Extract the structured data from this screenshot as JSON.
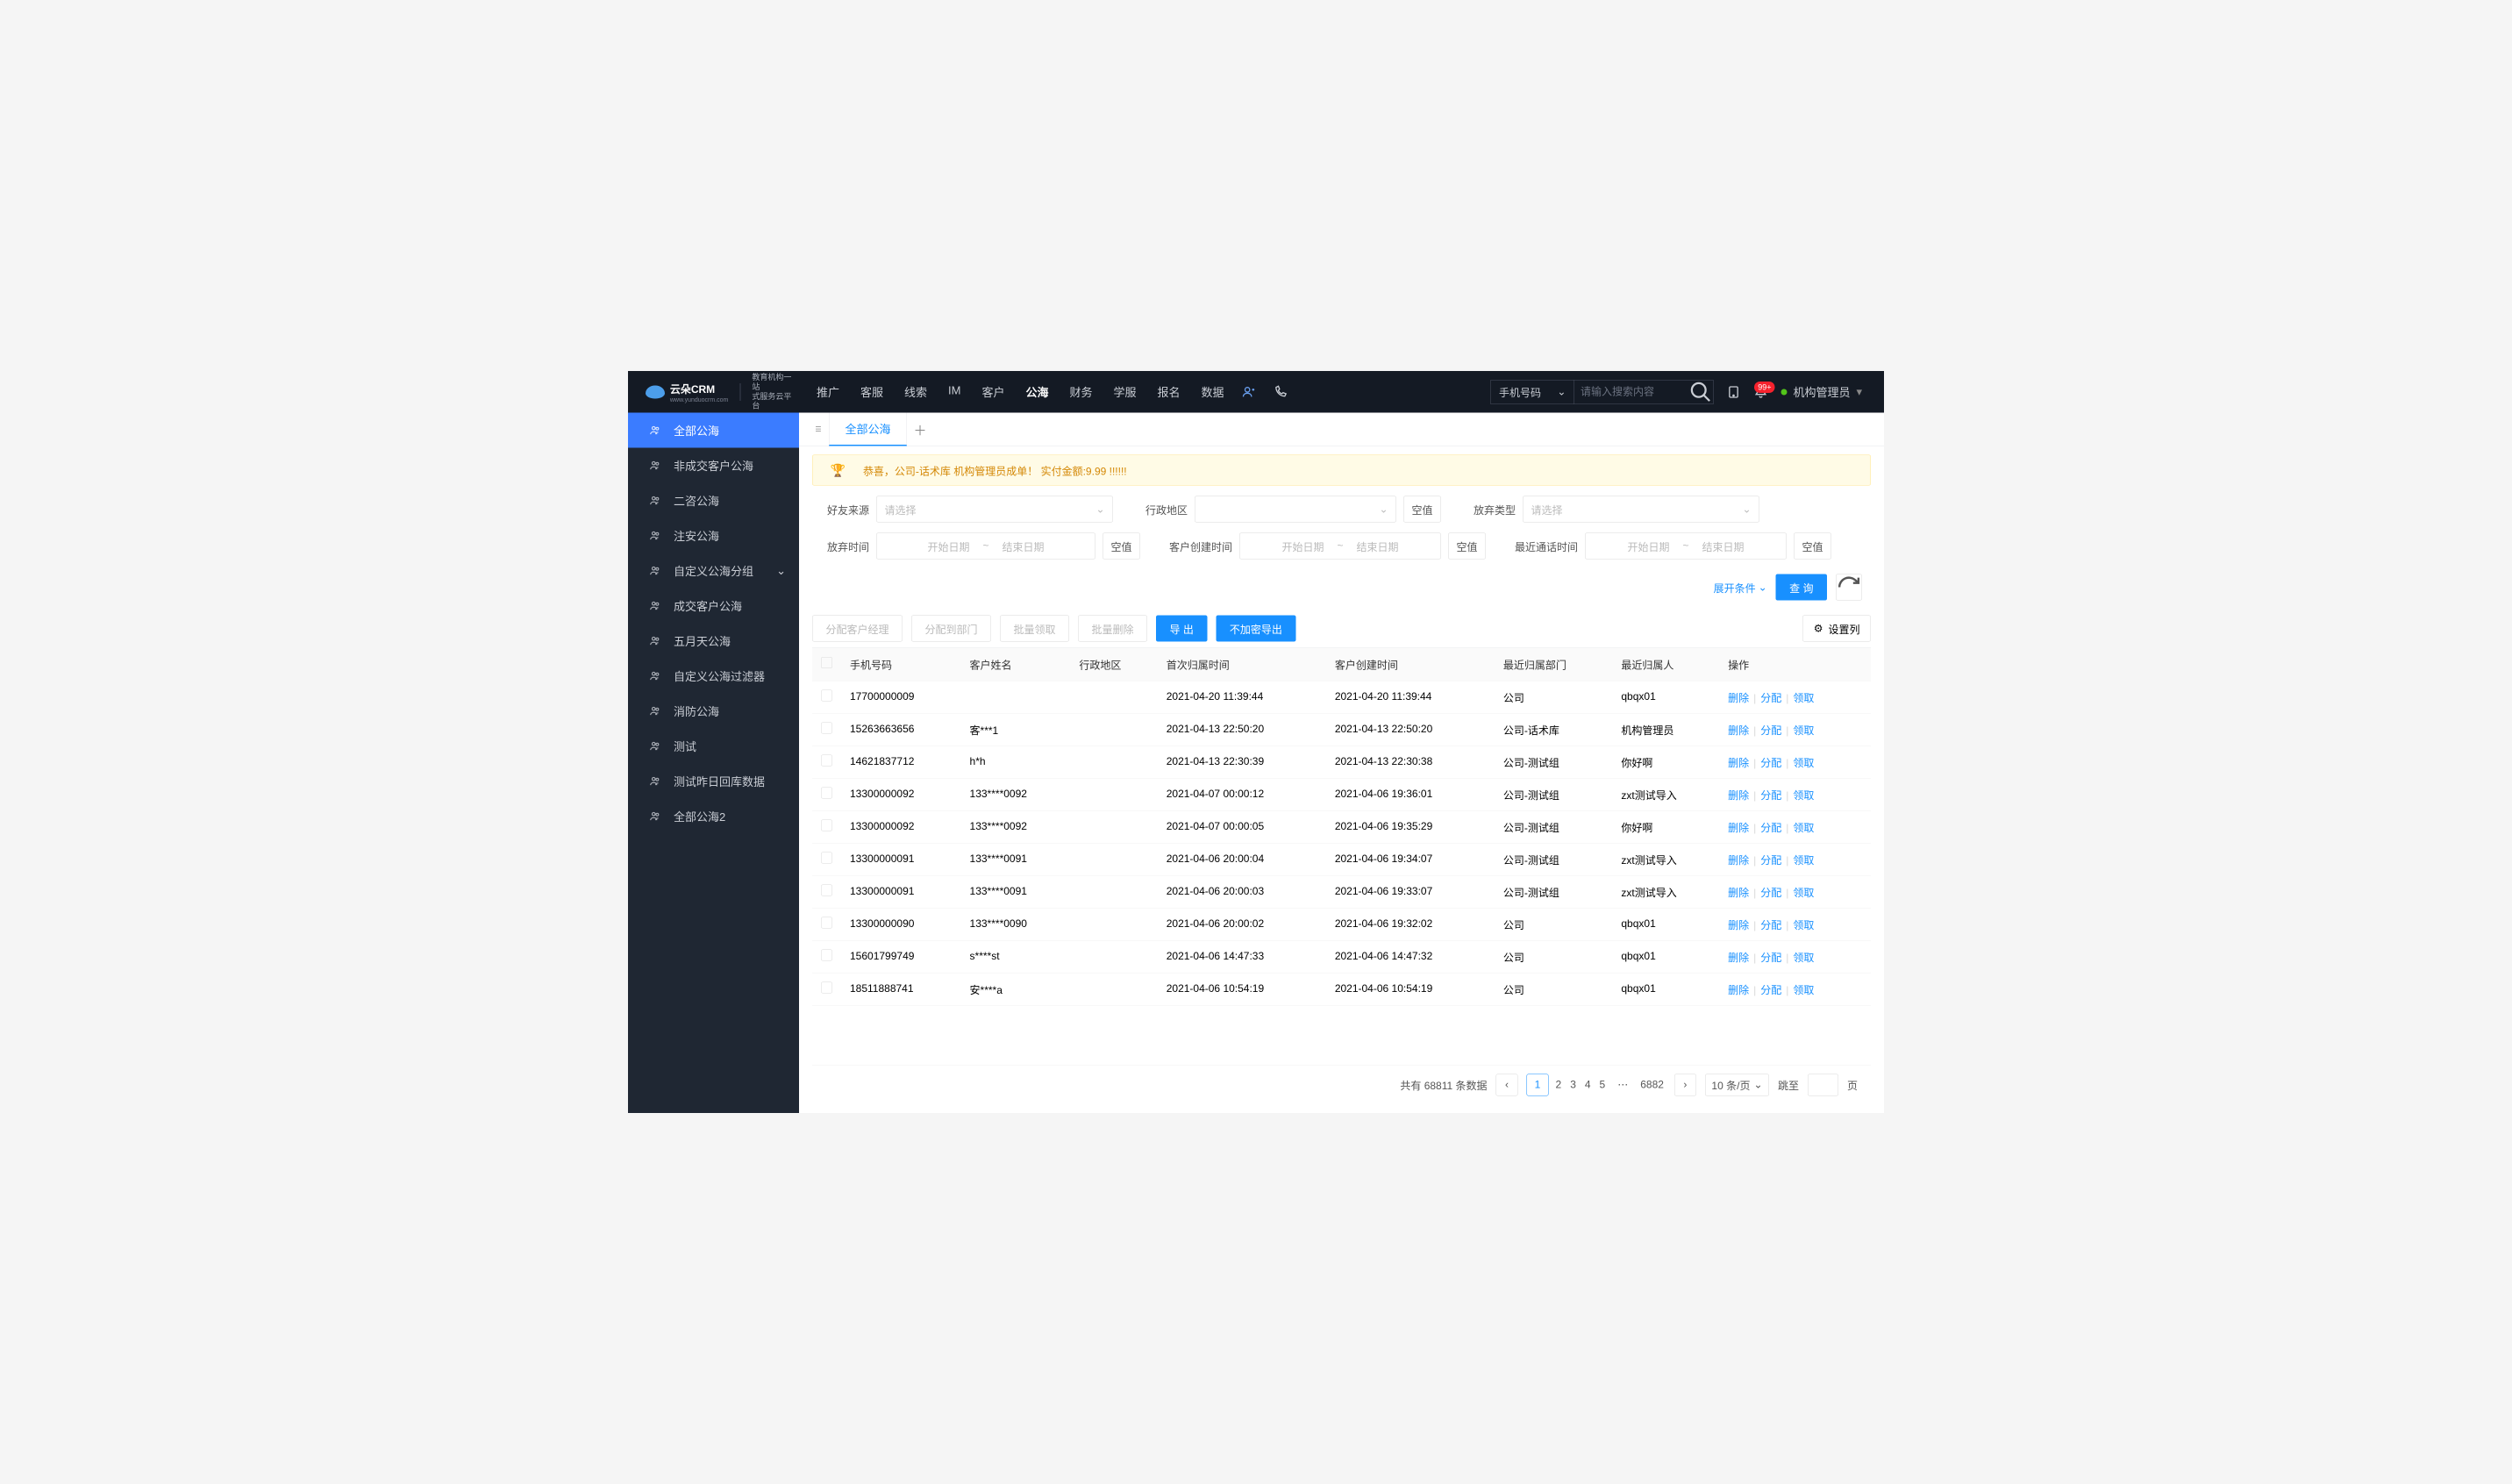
{
  "logo": {
    "brand": "云朵CRM",
    "sub1": "教育机构一站",
    "sub2": "式服务云平台",
    "url": "www.yunduocrm.com"
  },
  "nav": [
    "推广",
    "客服",
    "线索",
    "IM",
    "客户",
    "公海",
    "财务",
    "学服",
    "报名",
    "数据"
  ],
  "nav_active": 5,
  "search": {
    "type": "手机号码",
    "placeholder": "请输入搜索内容"
  },
  "notif_badge": "99+",
  "user": "机构管理员",
  "sidebar": [
    {
      "label": "全部公海",
      "active": true
    },
    {
      "label": "非成交客户公海"
    },
    {
      "label": "二咨公海"
    },
    {
      "label": "注安公海"
    },
    {
      "label": "自定义公海分组",
      "expand": true
    },
    {
      "label": "成交客户公海"
    },
    {
      "label": "五月天公海"
    },
    {
      "label": "自定义公海过滤器"
    },
    {
      "label": "消防公海"
    },
    {
      "label": "测试"
    },
    {
      "label": "测试昨日回库数据"
    },
    {
      "label": "全部公海2"
    }
  ],
  "tabs": {
    "active": "全部公海"
  },
  "banner": "恭喜，公司-话术库  机构管理员成单！  实付金额:9.99 !!!!!!",
  "filters": {
    "friend_source": {
      "label": "好友来源",
      "ph": "请选择"
    },
    "region": {
      "label": "行政地区",
      "ph": ""
    },
    "abandon_type": {
      "label": "放弃类型",
      "ph": "请选择"
    },
    "abandon_time": {
      "label": "放弃时间"
    },
    "create_time": {
      "label": "客户创建时间"
    },
    "call_time": {
      "label": "最近通话时间"
    },
    "date_start": "开始日期",
    "date_end": "结束日期",
    "null_btn": "空值",
    "expand": "展开条件",
    "query": "查 询"
  },
  "toolbar": {
    "assign_mgr": "分配客户经理",
    "assign_dept": "分配到部门",
    "batch_claim": "批量领取",
    "batch_del": "批量删除",
    "export": "导 出",
    "export_plain": "不加密导出",
    "set_cols": "设置列"
  },
  "table": {
    "cols": [
      "手机号码",
      "客户姓名",
      "行政地区",
      "首次归属时间",
      "客户创建时间",
      "最近归属部门",
      "最近归属人",
      "操作"
    ],
    "op": {
      "del": "删除",
      "assign": "分配",
      "claim": "领取"
    },
    "rows": [
      {
        "phone": "17700000009",
        "name": "",
        "region": "",
        "first": "2021-04-20 11:39:44",
        "created": "2021-04-20 11:39:44",
        "dept": "公司",
        "owner": "qbqx01"
      },
      {
        "phone": "15263663656",
        "name": "客***1",
        "region": "",
        "first": "2021-04-13 22:50:20",
        "created": "2021-04-13 22:50:20",
        "dept": "公司-话术库",
        "owner": "机构管理员"
      },
      {
        "phone": "14621837712",
        "name": "h*h",
        "region": "",
        "first": "2021-04-13 22:30:39",
        "created": "2021-04-13 22:30:38",
        "dept": "公司-测试组",
        "owner": "你好啊"
      },
      {
        "phone": "13300000092",
        "name": "133****0092",
        "region": "",
        "first": "2021-04-07 00:00:12",
        "created": "2021-04-06 19:36:01",
        "dept": "公司-测试组",
        "owner": "zxt测试导入"
      },
      {
        "phone": "13300000092",
        "name": "133****0092",
        "region": "",
        "first": "2021-04-07 00:00:05",
        "created": "2021-04-06 19:35:29",
        "dept": "公司-测试组",
        "owner": "你好啊"
      },
      {
        "phone": "13300000091",
        "name": "133****0091",
        "region": "",
        "first": "2021-04-06 20:00:04",
        "created": "2021-04-06 19:34:07",
        "dept": "公司-测试组",
        "owner": "zxt测试导入"
      },
      {
        "phone": "13300000091",
        "name": "133****0091",
        "region": "",
        "first": "2021-04-06 20:00:03",
        "created": "2021-04-06 19:33:07",
        "dept": "公司-测试组",
        "owner": "zxt测试导入"
      },
      {
        "phone": "13300000090",
        "name": "133****0090",
        "region": "",
        "first": "2021-04-06 20:00:02",
        "created": "2021-04-06 19:32:02",
        "dept": "公司",
        "owner": "qbqx01"
      },
      {
        "phone": "15601799749",
        "name": "s****st",
        "region": "",
        "first": "2021-04-06 14:47:33",
        "created": "2021-04-06 14:47:32",
        "dept": "公司",
        "owner": "qbqx01"
      },
      {
        "phone": "18511888741",
        "name": "安****a",
        "region": "",
        "first": "2021-04-06 10:54:19",
        "created": "2021-04-06 10:54:19",
        "dept": "公司",
        "owner": "qbqx01"
      }
    ]
  },
  "pager": {
    "total_prefix": "共有",
    "total": "68811",
    "total_suffix": "条数据",
    "pages": [
      "1",
      "2",
      "3",
      "4",
      "5"
    ],
    "last": "6882",
    "size": "10 条/页",
    "jump": "跳至",
    "page_suffix": "页"
  }
}
